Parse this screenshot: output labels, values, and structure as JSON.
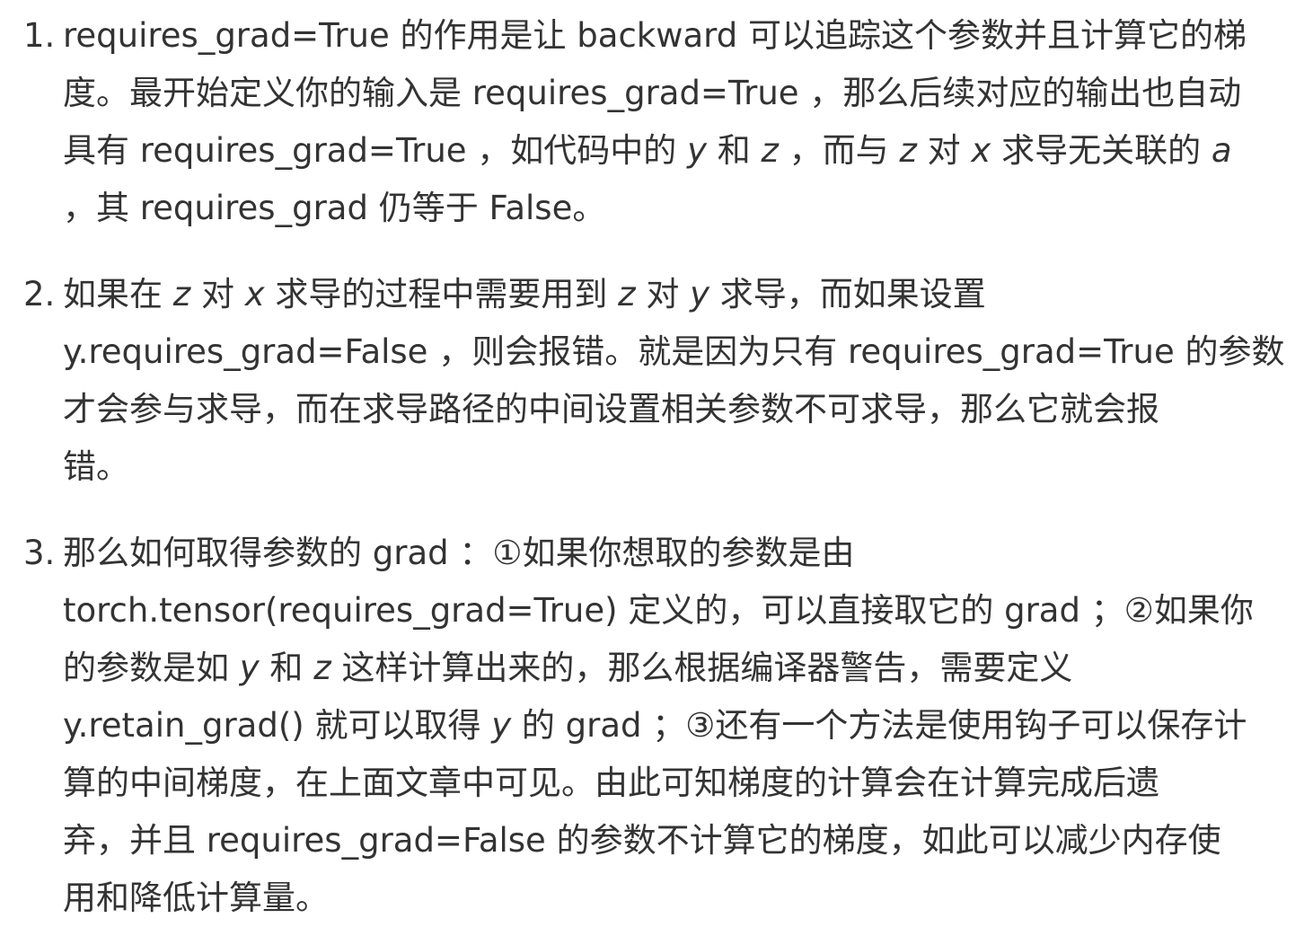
{
  "list": {
    "items": [
      {
        "number": "1.",
        "lines": [
          [
            {
              "t": "requires_grad=True 的作用是让 backward 可以追踪这个参数并且计算它的梯"
            }
          ],
          [
            {
              "t": "度。最开始定义你的输入是 requires_grad=True ，那么后续对应的输出也自动"
            }
          ],
          [
            {
              "t": "具有 requires_grad=True ，如代码中的 "
            },
            {
              "t": "y",
              "math": true
            },
            {
              "t": " 和 "
            },
            {
              "t": "z",
              "math": true
            },
            {
              "t": " ，而与 "
            },
            {
              "t": "z",
              "math": true
            },
            {
              "t": " 对 "
            },
            {
              "t": "x",
              "math": true
            },
            {
              "t": " 求导无关联的 "
            },
            {
              "t": "a",
              "math": true
            }
          ],
          [
            {
              "t": "，其 requires_grad 仍等于 False。"
            }
          ]
        ]
      },
      {
        "number": "2.",
        "lines": [
          [
            {
              "t": "如果在 "
            },
            {
              "t": "z",
              "math": true
            },
            {
              "t": " 对 "
            },
            {
              "t": "x",
              "math": true
            },
            {
              "t": " 求导的过程中需要用到 "
            },
            {
              "t": "z",
              "math": true
            },
            {
              "t": " 对 "
            },
            {
              "t": "y",
              "math": true
            },
            {
              "t": " 求导，而如果设置"
            }
          ],
          [
            {
              "t": "y.requires_grad=False ，则会报错。就是因为只有 requires_grad=True 的参数"
            }
          ],
          [
            {
              "t": "才会参与求导，而在求导路径的中间设置相关参数不可求导，那么它就会报"
            }
          ],
          [
            {
              "t": "错。"
            }
          ]
        ]
      },
      {
        "number": "3.",
        "lines": [
          [
            {
              "t": "那么如何取得参数的 grad ：①如果你想取的参数是由"
            }
          ],
          [
            {
              "t": "torch.tensor(requires_grad=True) 定义的，可以直接取它的 grad ；②如果你"
            }
          ],
          [
            {
              "t": "的参数是如 "
            },
            {
              "t": "y",
              "math": true
            },
            {
              "t": " 和 "
            },
            {
              "t": "z",
              "math": true
            },
            {
              "t": " 这样计算出来的，那么根据编译器警告，需要定义"
            }
          ],
          [
            {
              "t": "y.retain_grad() 就可以取得 "
            },
            {
              "t": "y",
              "math": true
            },
            {
              "t": " 的 grad ；③还有一个方法是使用钩子可以保存计"
            }
          ],
          [
            {
              "t": "算的中间梯度，在上面文章中可见。由此可知梯度的计算会在计算完成后遗"
            }
          ],
          [
            {
              "t": "弃，并且 requires_grad=False 的参数不计算它的梯度，如此可以减少内存使"
            }
          ],
          [
            {
              "t": "用和降低计算量。"
            }
          ]
        ]
      }
    ]
  }
}
